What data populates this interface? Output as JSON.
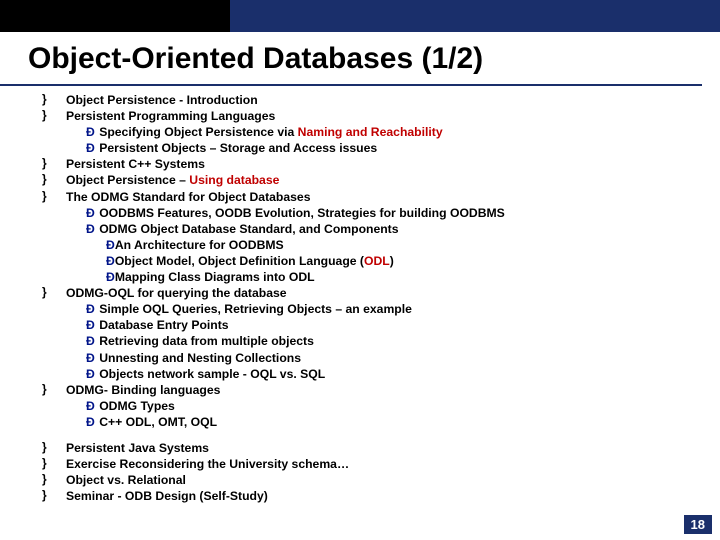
{
  "title": "Object-Oriented Databases (1/2)",
  "pageNumber": "18",
  "arrow": "Ð",
  "items": {
    "i1": "Object Persistence - Introduction",
    "i2": "Persistent Programming Languages",
    "i2s1a": " Specifying Object Persistence  via ",
    "i2s1b": "Naming and Reachability",
    "i2s2": " Persistent Objects – Storage and Access issues",
    "i3": "Persistent C++ Systems",
    "i4a": "Object Persistence – ",
    "i4b": "Using database",
    "i5": "The ODMG Standard for Object Databases",
    "i5s1": " OODBMS Features, OODB Evolution, Strategies for building OODBMS",
    "i5s2": " ODMG Object Database Standard, and Components",
    "i5s2a": "An Architecture for OODBMS",
    "i5s2b_a": "Object Model, Object Definition Language (",
    "i5s2b_b": "ODL",
    "i5s2b_c": ")",
    "i5s2c": "Mapping Class Diagrams into ODL",
    "i6": "ODMG-OQL for querying the database",
    "i6s1": " Simple OQL Queries, Retrieving Objects – an example",
    "i6s2": " Database Entry Points",
    "i6s3": " Retrieving data from multiple objects",
    "i6s4": " Unnesting and Nesting Collections",
    "i6s5": " Objects network sample - OQL vs. SQL",
    "i7": "ODMG- Binding languages",
    "i7s1": " ODMG Types",
    "i7s2": " C++ ODL, OMT, OQL",
    "i8": "Persistent Java Systems",
    "i9": "Exercise Reconsidering the University schema…",
    "i10": "Object vs. Relational",
    "i11": "Seminar - ODB Design (Self-Study)"
  }
}
